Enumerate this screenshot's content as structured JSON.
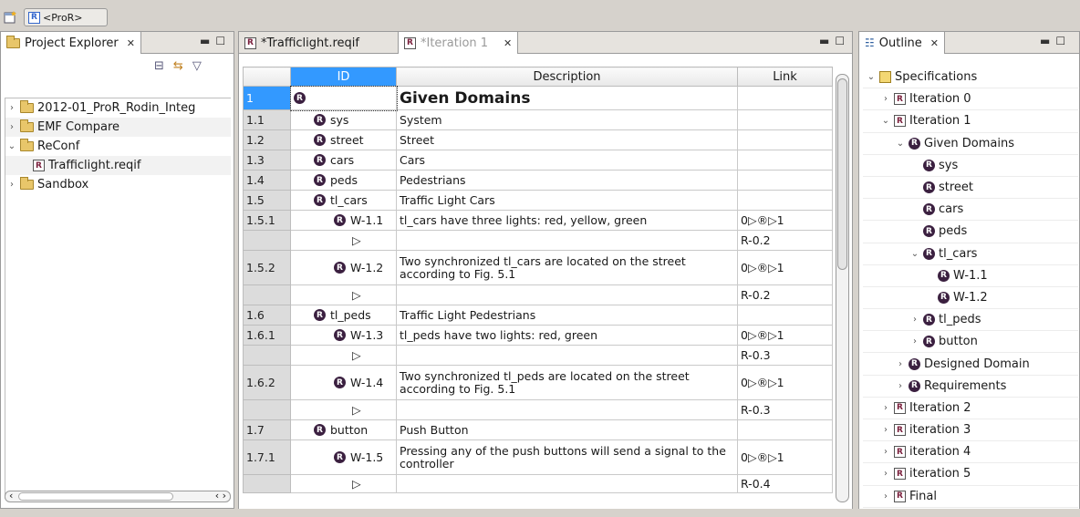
{
  "toolbar": {
    "perspective_label": "<ProR>"
  },
  "explorer": {
    "tab_label": "Project Explorer",
    "items": [
      {
        "label": "2012-01_ProR_Rodin_Integ",
        "kind": "folder",
        "depth": 0,
        "expander": "›"
      },
      {
        "label": "EMF Compare",
        "kind": "folder",
        "depth": 0,
        "expander": "›"
      },
      {
        "label": "ReConf",
        "kind": "folder",
        "depth": 0,
        "expander": "⌄"
      },
      {
        "label": "Trafficlight.reqif",
        "kind": "reqif",
        "depth": 1,
        "expander": ""
      },
      {
        "label": "Sandbox",
        "kind": "folder",
        "depth": 0,
        "expander": "›"
      }
    ]
  },
  "editor": {
    "tabs": [
      {
        "label": "*Trafficlight.reqif",
        "active": false
      },
      {
        "label": "*Iteration 1",
        "active": true
      }
    ],
    "columns": {
      "id": "ID",
      "description": "Description",
      "link": "Link"
    },
    "rows": [
      {
        "num": "1",
        "indent": 0,
        "badge": true,
        "id": "",
        "desc": "Given Domains",
        "link": "",
        "big": true,
        "sel": true,
        "h": 26
      },
      {
        "num": "1.1",
        "indent": 1,
        "badge": true,
        "id": "sys",
        "desc": "System",
        "link": "",
        "h": 22
      },
      {
        "num": "1.2",
        "indent": 1,
        "badge": true,
        "id": "street",
        "desc": "Street",
        "link": "",
        "h": 22
      },
      {
        "num": "1.3",
        "indent": 1,
        "badge": true,
        "id": "cars",
        "desc": "Cars",
        "link": "",
        "h": 22
      },
      {
        "num": "1.4",
        "indent": 1,
        "badge": true,
        "id": "peds",
        "desc": "Pedestrians",
        "link": "",
        "h": 22
      },
      {
        "num": "1.5",
        "indent": 1,
        "badge": true,
        "id": "tl_cars",
        "desc": "Traffic Light Cars",
        "link": "",
        "h": 22
      },
      {
        "num": "1.5.1",
        "indent": 2,
        "badge": true,
        "id": "W-1.1",
        "desc": "tl_cars have three lights: red, yellow, green",
        "link": "0▷®▷1",
        "h": 22
      },
      {
        "num": "",
        "indent": 3,
        "badge": false,
        "id": "▷",
        "desc": "",
        "link": "R-0.2",
        "h": 22
      },
      {
        "num": "1.5.2",
        "indent": 2,
        "badge": true,
        "id": "W-1.2",
        "desc": "Two synchronized tl_cars are located on the street according to Fig. 5.1",
        "link": "0▷®▷1",
        "h": 38
      },
      {
        "num": "",
        "indent": 3,
        "badge": false,
        "id": "▷",
        "desc": "",
        "link": "R-0.2",
        "h": 22
      },
      {
        "num": "1.6",
        "indent": 1,
        "badge": true,
        "id": "tl_peds",
        "desc": "Traffic Light Pedestrians",
        "link": "",
        "h": 22
      },
      {
        "num": "1.6.1",
        "indent": 2,
        "badge": true,
        "id": "W-1.3",
        "desc": "tl_peds have two lights: red, green",
        "link": "0▷®▷1",
        "h": 22
      },
      {
        "num": "",
        "indent": 3,
        "badge": false,
        "id": "▷",
        "desc": "",
        "link": "R-0.3",
        "h": 22
      },
      {
        "num": "1.6.2",
        "indent": 2,
        "badge": true,
        "id": "W-1.4",
        "desc": "Two synchronized tl_peds are located on the street according to Fig. 5.1",
        "link": "0▷®▷1",
        "h": 38
      },
      {
        "num": "",
        "indent": 3,
        "badge": false,
        "id": "▷",
        "desc": "",
        "link": "R-0.3",
        "h": 22
      },
      {
        "num": "1.7",
        "indent": 1,
        "badge": true,
        "id": "button",
        "desc": "Push Button",
        "link": "",
        "h": 22
      },
      {
        "num": "1.7.1",
        "indent": 2,
        "badge": true,
        "id": "W-1.5",
        "desc": "Pressing any of the push buttons will send a signal to the controller",
        "link": "0▷®▷1",
        "h": 38
      },
      {
        "num": "",
        "indent": 3,
        "badge": false,
        "id": "▷",
        "desc": "",
        "link": "R-0.4",
        "h": 20
      }
    ]
  },
  "outline": {
    "tab_label": "Outline",
    "items": [
      {
        "label": "Specifications",
        "kind": "spec",
        "depth": 0,
        "expander": "⌄"
      },
      {
        "label": "Iteration 0",
        "kind": "reqif",
        "depth": 1,
        "expander": "›"
      },
      {
        "label": "Iteration 1",
        "kind": "reqif",
        "depth": 1,
        "expander": "⌄"
      },
      {
        "label": "Given Domains",
        "kind": "badge",
        "depth": 2,
        "expander": "⌄"
      },
      {
        "label": "sys",
        "kind": "badge",
        "depth": 3,
        "expander": ""
      },
      {
        "label": "street",
        "kind": "badge",
        "depth": 3,
        "expander": ""
      },
      {
        "label": "cars",
        "kind": "badge",
        "depth": 3,
        "expander": ""
      },
      {
        "label": "peds",
        "kind": "badge",
        "depth": 3,
        "expander": ""
      },
      {
        "label": "tl_cars",
        "kind": "badge",
        "depth": 3,
        "expander": "⌄"
      },
      {
        "label": "W-1.1",
        "kind": "badge",
        "depth": 4,
        "expander": ""
      },
      {
        "label": "W-1.2",
        "kind": "badge",
        "depth": 4,
        "expander": ""
      },
      {
        "label": "tl_peds",
        "kind": "badge",
        "depth": 3,
        "expander": "›"
      },
      {
        "label": "button",
        "kind": "badge",
        "depth": 3,
        "expander": "›"
      },
      {
        "label": "Designed Domain",
        "kind": "badge",
        "depth": 2,
        "expander": "›"
      },
      {
        "label": "Requirements",
        "kind": "badge",
        "depth": 2,
        "expander": "›"
      },
      {
        "label": "Iteration 2",
        "kind": "reqif",
        "depth": 1,
        "expander": "›"
      },
      {
        "label": "iteration 3",
        "kind": "reqif",
        "depth": 1,
        "expander": "›"
      },
      {
        "label": "iteration 4",
        "kind": "reqif",
        "depth": 1,
        "expander": "›"
      },
      {
        "label": "iteration 5",
        "kind": "reqif",
        "depth": 1,
        "expander": "›"
      },
      {
        "label": "Final",
        "kind": "reqif",
        "depth": 1,
        "expander": "›"
      }
    ]
  }
}
